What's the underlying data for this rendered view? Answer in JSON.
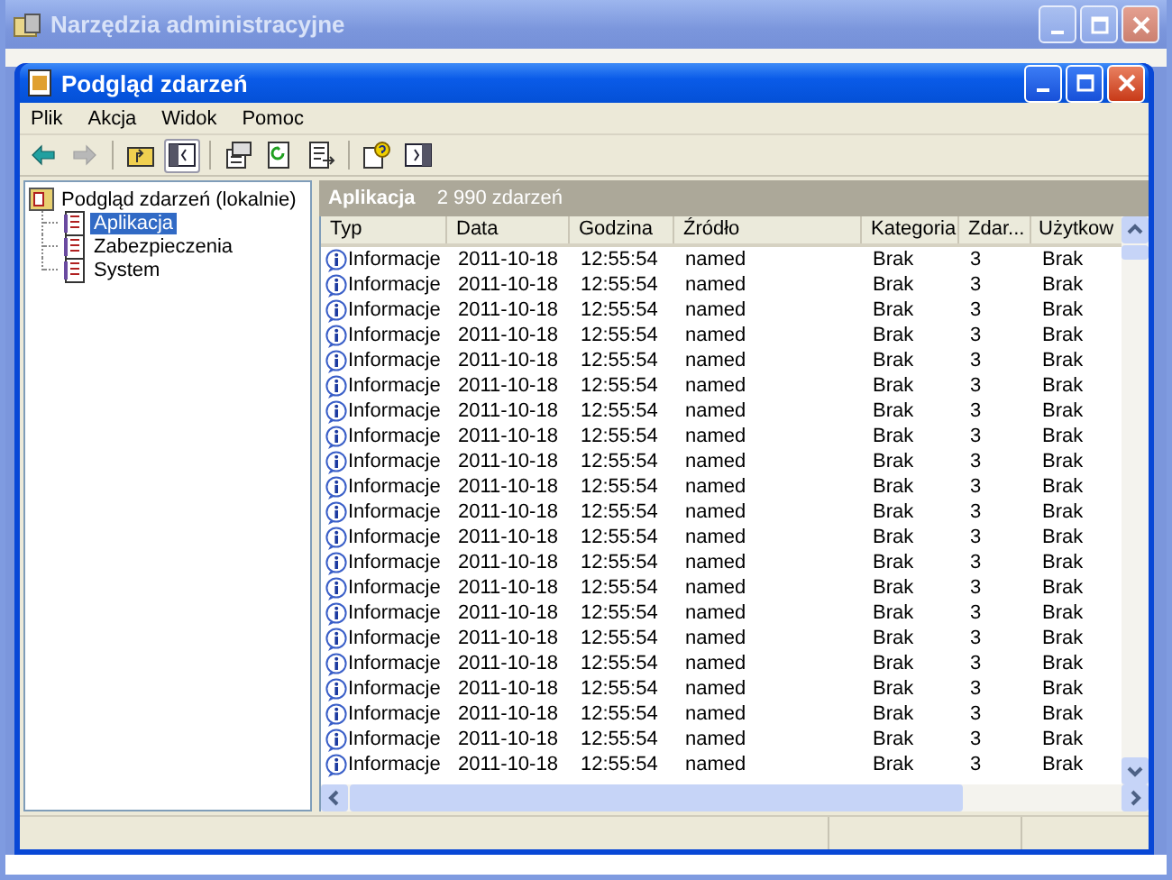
{
  "outer_window": {
    "title": "Narzędzia administracyjne"
  },
  "window": {
    "title": "Podgląd zdarzeń"
  },
  "menu": [
    "Plik",
    "Akcja",
    "Widok",
    "Pomoc"
  ],
  "toolbar": [
    {
      "kind": "back",
      "disabled": false
    },
    {
      "kind": "forward",
      "disabled": true
    },
    {
      "kind": "sep"
    },
    {
      "kind": "up-folder",
      "selected": false
    },
    {
      "kind": "tree-toggle",
      "selected": true
    },
    {
      "kind": "sep"
    },
    {
      "kind": "properties",
      "selected": false
    },
    {
      "kind": "refresh",
      "selected": false
    },
    {
      "kind": "export",
      "selected": false
    },
    {
      "kind": "sep"
    },
    {
      "kind": "help",
      "selected": false
    },
    {
      "kind": "panel",
      "selected": false
    }
  ],
  "tree": {
    "label": "Podgląd zdarzeń (lokalnie)",
    "children": [
      {
        "label": "Aplikacja",
        "selected": true
      },
      {
        "label": "Zabezpieczenia",
        "selected": false
      },
      {
        "label": "System",
        "selected": false
      }
    ]
  },
  "pane_header": {
    "title": "Aplikacja",
    "count": "2 990 zdarzeń"
  },
  "table": {
    "columns": [
      "Typ",
      "Data",
      "Godzina",
      "Źródło",
      "Kategoria",
      "Zdar...",
      "Użytkow"
    ],
    "rows": [
      [
        "Informacje",
        "2011-10-18",
        "12:55:54",
        "named",
        "Brak",
        "3",
        "Brak"
      ],
      [
        "Informacje",
        "2011-10-18",
        "12:55:54",
        "named",
        "Brak",
        "3",
        "Brak"
      ],
      [
        "Informacje",
        "2011-10-18",
        "12:55:54",
        "named",
        "Brak",
        "3",
        "Brak"
      ],
      [
        "Informacje",
        "2011-10-18",
        "12:55:54",
        "named",
        "Brak",
        "3",
        "Brak"
      ],
      [
        "Informacje",
        "2011-10-18",
        "12:55:54",
        "named",
        "Brak",
        "3",
        "Brak"
      ],
      [
        "Informacje",
        "2011-10-18",
        "12:55:54",
        "named",
        "Brak",
        "3",
        "Brak"
      ],
      [
        "Informacje",
        "2011-10-18",
        "12:55:54",
        "named",
        "Brak",
        "3",
        "Brak"
      ],
      [
        "Informacje",
        "2011-10-18",
        "12:55:54",
        "named",
        "Brak",
        "3",
        "Brak"
      ],
      [
        "Informacje",
        "2011-10-18",
        "12:55:54",
        "named",
        "Brak",
        "3",
        "Brak"
      ],
      [
        "Informacje",
        "2011-10-18",
        "12:55:54",
        "named",
        "Brak",
        "3",
        "Brak"
      ],
      [
        "Informacje",
        "2011-10-18",
        "12:55:54",
        "named",
        "Brak",
        "3",
        "Brak"
      ],
      [
        "Informacje",
        "2011-10-18",
        "12:55:54",
        "named",
        "Brak",
        "3",
        "Brak"
      ],
      [
        "Informacje",
        "2011-10-18",
        "12:55:54",
        "named",
        "Brak",
        "3",
        "Brak"
      ],
      [
        "Informacje",
        "2011-10-18",
        "12:55:54",
        "named",
        "Brak",
        "3",
        "Brak"
      ],
      [
        "Informacje",
        "2011-10-18",
        "12:55:54",
        "named",
        "Brak",
        "3",
        "Brak"
      ],
      [
        "Informacje",
        "2011-10-18",
        "12:55:54",
        "named",
        "Brak",
        "3",
        "Brak"
      ],
      [
        "Informacje",
        "2011-10-18",
        "12:55:54",
        "named",
        "Brak",
        "3",
        "Brak"
      ],
      [
        "Informacje",
        "2011-10-18",
        "12:55:54",
        "named",
        "Brak",
        "3",
        "Brak"
      ],
      [
        "Informacje",
        "2011-10-18",
        "12:55:54",
        "named",
        "Brak",
        "3",
        "Brak"
      ],
      [
        "Informacje",
        "2011-10-18",
        "12:55:54",
        "named",
        "Brak",
        "3",
        "Brak"
      ],
      [
        "Informacje",
        "2011-10-18",
        "12:55:54",
        "named",
        "Brak",
        "3",
        "Brak"
      ]
    ]
  }
}
